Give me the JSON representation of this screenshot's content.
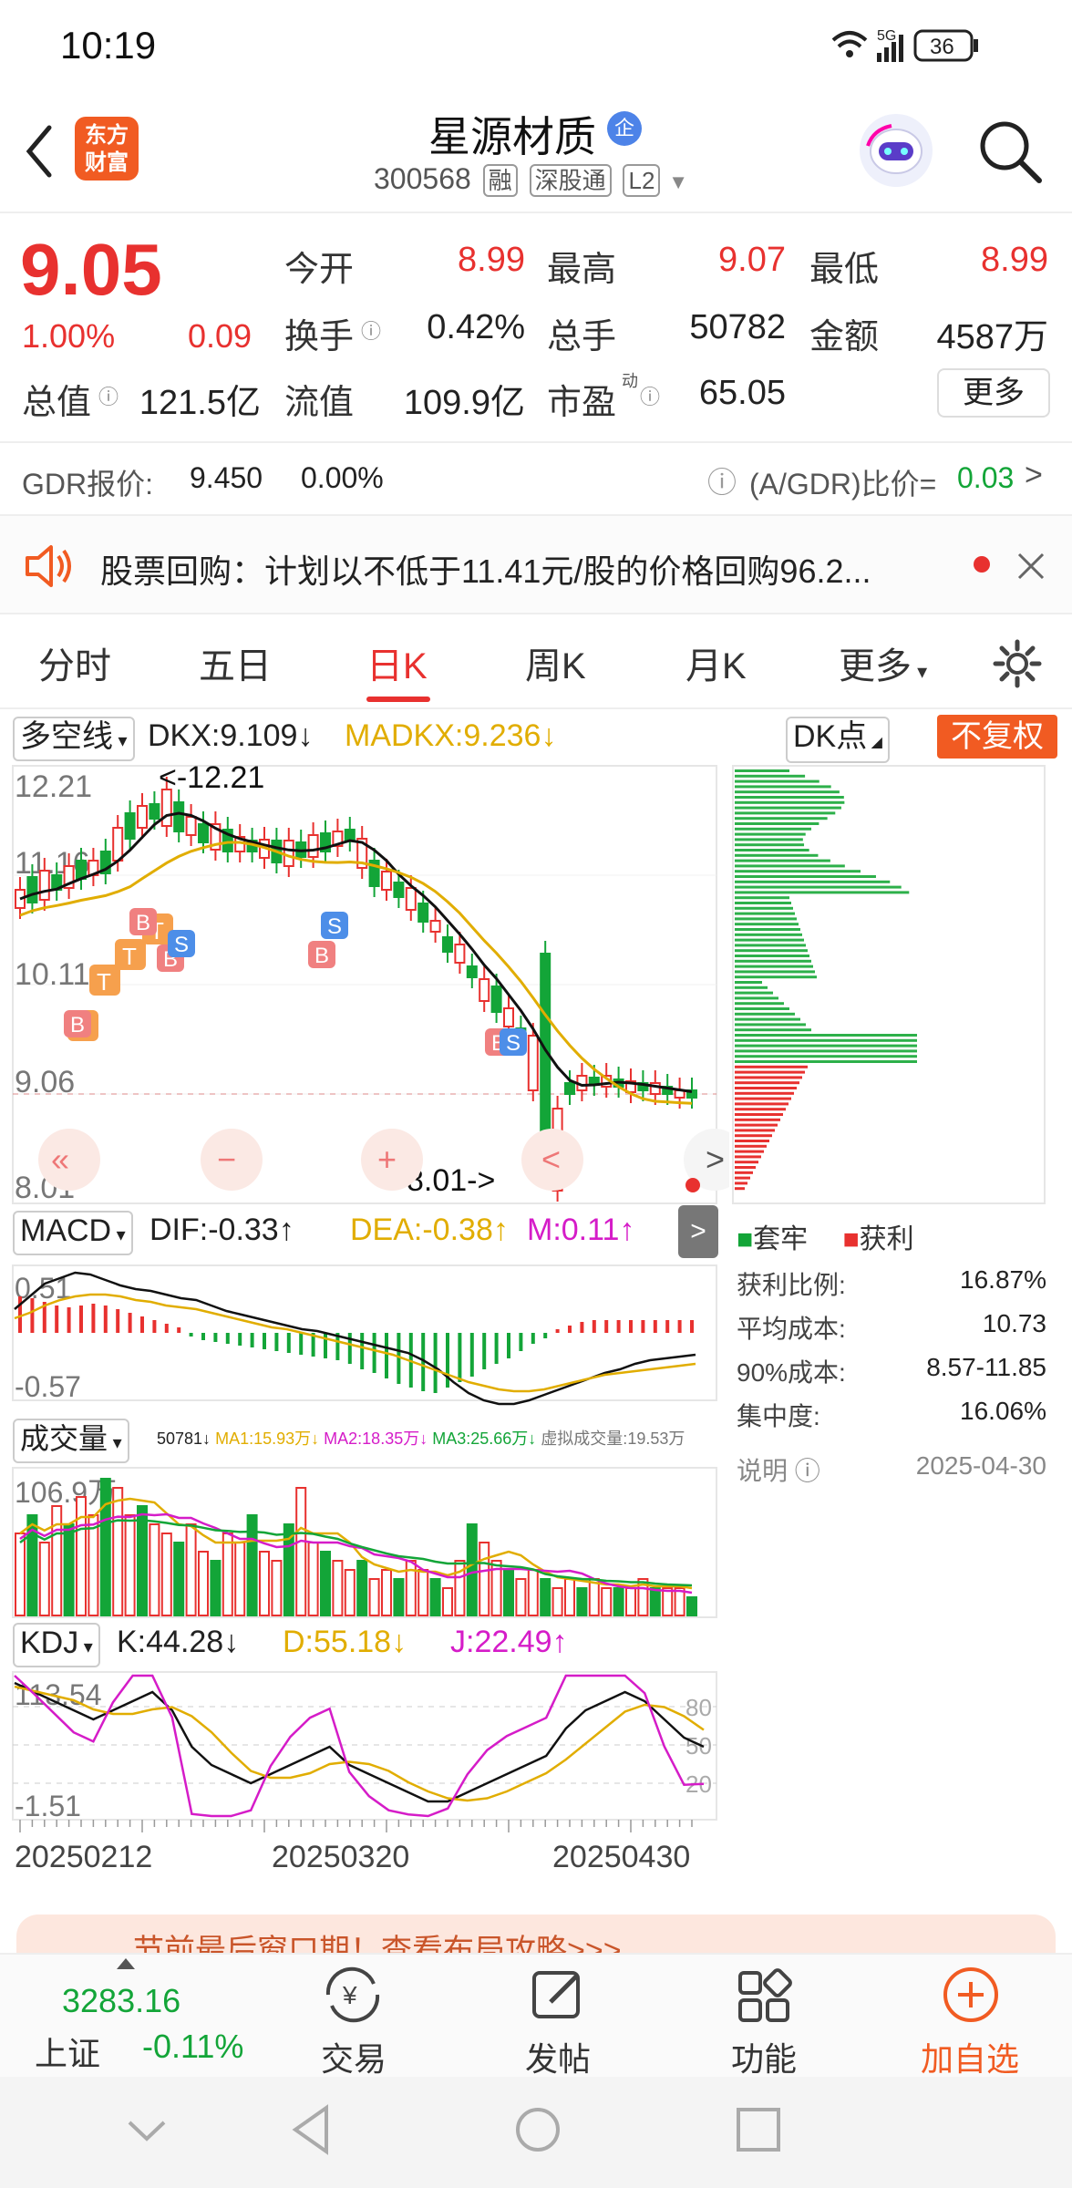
{
  "status": {
    "time": "10:19",
    "network": "5G",
    "battery": "36"
  },
  "header": {
    "title": "星源材质",
    "badge": "企",
    "code": "300568",
    "tags": [
      "融",
      "深股通",
      "L2"
    ],
    "logo_line1": "东方",
    "logo_line2": "财富"
  },
  "quote": {
    "price": "9.05",
    "change_pct": "1.00%",
    "change": "0.09",
    "open_label": "今开",
    "open": "8.99",
    "high_label": "最高",
    "high": "9.07",
    "low_label": "最低",
    "low": "8.99",
    "turnover_label": "换手",
    "turnover": "0.42%",
    "volume_label": "总手",
    "volume": "50782",
    "amount_label": "金额",
    "amount": "4587万",
    "mktcap_label": "总值",
    "mktcap": "121.5亿",
    "float_label": "流值",
    "float": "109.9亿",
    "pe_label": "市盈",
    "pe_sup": "动",
    "pe": "65.05",
    "more": "更多"
  },
  "gdr": {
    "label": "GDR报价:",
    "price": "9.450",
    "pct": "0.00%",
    "ratio_label": "(A/GDR)比价=",
    "ratio": "0.03"
  },
  "notice": {
    "text": "股票回购：计划以不低于11.41元/股的价格回购96.2..."
  },
  "tabs": [
    "分时",
    "五日",
    "日K",
    "周K",
    "月K",
    "更多"
  ],
  "active_tab": 2,
  "main_indicator": {
    "name": "多空线",
    "dkx": "DKX:9.109↓",
    "madkx": "MADKX:9.236↓",
    "dk_btn": "DK点",
    "fq_btn": "不复权"
  },
  "price_axis": {
    "high": "12.21",
    "mid1": "11.16",
    "mid2": "10.11",
    "mid3": "9.06",
    "low": "8.01"
  },
  "annotations": {
    "max": "<-12.21",
    "min": "8.01->"
  },
  "macd": {
    "name": "MACD",
    "dif": "DIF:-0.33↑",
    "dea": "DEA:-0.38↑",
    "m": "M:0.11↑",
    "top": "0.51",
    "bottom": "-0.57"
  },
  "vol": {
    "name": "成交量",
    "v": "50781↓",
    "ma1": "MA1:15.93万↓",
    "ma2": "MA2:18.35万↓",
    "ma3": "MA3:25.66万↓",
    "virtual": "虚拟成交量:19.53万",
    "top": "106.9万"
  },
  "kdj": {
    "name": "KDJ",
    "k": "K:44.28↓",
    "d": "D:55.18↓",
    "j": "J:22.49↑",
    "top": "113.54",
    "bottom": "-1.51",
    "l80": "80",
    "l50": "50",
    "l20": "20"
  },
  "dates": [
    "20250212",
    "20250320",
    "20250430"
  ],
  "chips": {
    "legend_trap": "套牢",
    "legend_profit": "获利",
    "rows": [
      {
        "label": "获利比例:",
        "value": "16.87%"
      },
      {
        "label": "平均成本:",
        "value": "10.73"
      },
      {
        "label": "90%成本:",
        "value": "8.57-11.85"
      },
      {
        "label": "集中度:",
        "value": "16.06%"
      }
    ],
    "note_label": "说明",
    "date": "2025-04-30"
  },
  "promo": {
    "text": "节前最后窗口期！查看布局攻略>>>"
  },
  "bottom_nav": {
    "index_value": "3283.16",
    "index_name": "上证",
    "index_pct": "-0.11%",
    "items": [
      "交易",
      "发帖",
      "功能",
      "加自选"
    ]
  },
  "colors": {
    "up": "#e8312f",
    "down": "#13a538",
    "accent": "#f15b22",
    "ma_gold": "#e1ad00",
    "magenta": "#d51cc8"
  }
}
